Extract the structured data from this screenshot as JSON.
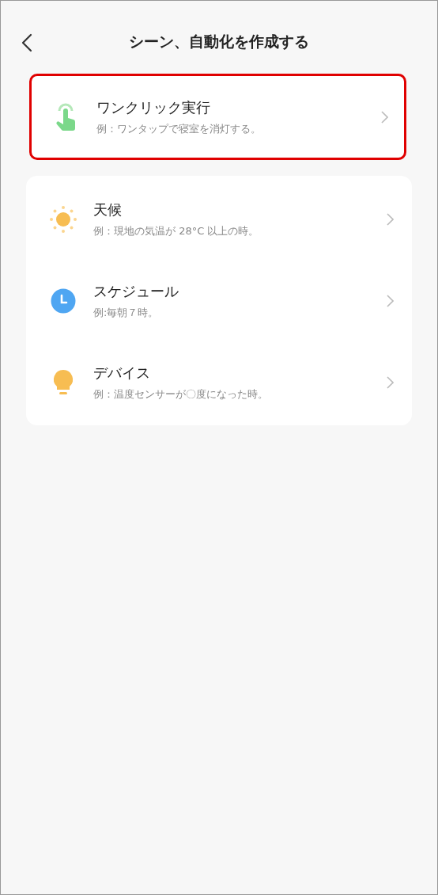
{
  "header": {
    "title": "シーン、自動化を作成する"
  },
  "sections": [
    {
      "highlighted": true,
      "items": [
        {
          "kind": "tap",
          "title": "ワンクリック実行",
          "example": "例：ワンタップで寝室を消灯する。"
        }
      ]
    },
    {
      "highlighted": false,
      "items": [
        {
          "kind": "weather",
          "title": "天候",
          "example": "例：現地の気温が 28°C 以上の時。"
        },
        {
          "kind": "schedule",
          "title": "スケジュール",
          "example": "例:毎朝７時。"
        },
        {
          "kind": "device",
          "title": "デバイス",
          "example": "例：温度センサーが〇度になった時。"
        }
      ]
    }
  ]
}
